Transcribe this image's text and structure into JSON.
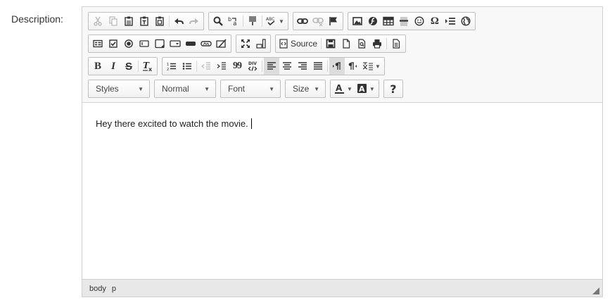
{
  "field": {
    "label": "Description:"
  },
  "toolbar": {
    "source_label": "Source",
    "styles_label": "Styles",
    "format_label": "Normal",
    "font_label": "Font",
    "size_label": "Size",
    "bold_glyph": "B",
    "italic_glyph": "I",
    "strike_glyph": "S",
    "omega_glyph": "Ω",
    "help_glyph": "?",
    "quote_glyph": "99",
    "div_glyph": "DIV"
  },
  "editor": {
    "content_text": "Hey there excited to watch the movie."
  },
  "statusbar": {
    "path": [
      "body",
      "p"
    ]
  },
  "colors": {
    "toolbar_bg": "#f8f8f8",
    "border": "#d1d1d1",
    "statusbar_bg": "#e8e8e8",
    "active_button": "#dcdcdc"
  }
}
